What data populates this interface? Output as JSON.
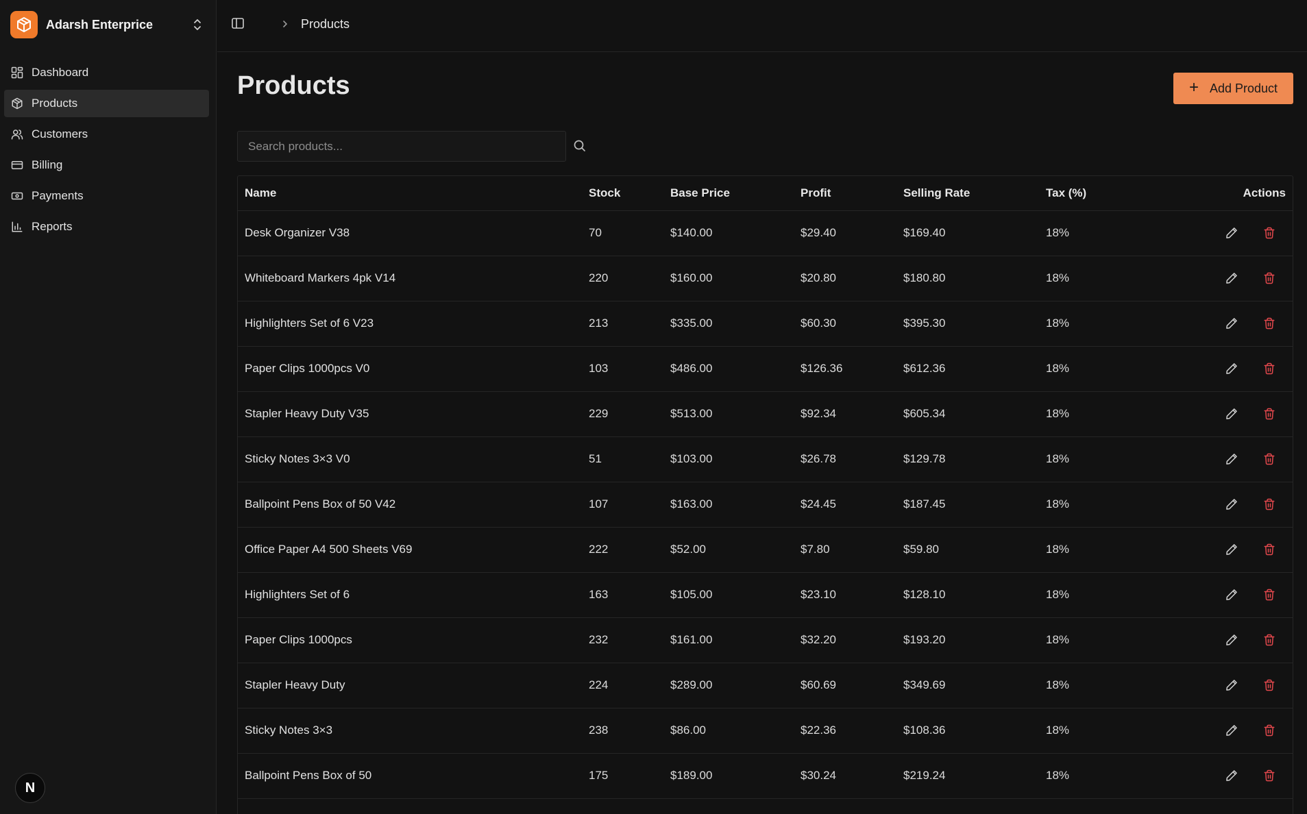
{
  "brand": {
    "name": "Adarsh Enterprice"
  },
  "sidebar": {
    "items": [
      {
        "label": "Dashboard",
        "icon": "dashboard-icon"
      },
      {
        "label": "Products",
        "icon": "package-icon",
        "active": true
      },
      {
        "label": "Customers",
        "icon": "users-icon"
      },
      {
        "label": "Billing",
        "icon": "card-icon"
      },
      {
        "label": "Payments",
        "icon": "banknote-icon"
      },
      {
        "label": "Reports",
        "icon": "bar-chart-icon"
      }
    ],
    "badge": "N"
  },
  "breadcrumb": {
    "current": "Products"
  },
  "main": {
    "title": "Products",
    "add_label": "Add Product",
    "search_placeholder": "Search products..."
  },
  "table": {
    "headers": [
      "Name",
      "Stock",
      "Base Price",
      "Profit",
      "Selling Rate",
      "Tax (%)",
      "Actions"
    ],
    "rows": [
      [
        "Desk Organizer V38",
        "70",
        "$140.00",
        "$29.40",
        "$169.40",
        "18%"
      ],
      [
        "Whiteboard Markers 4pk V14",
        "220",
        "$160.00",
        "$20.80",
        "$180.80",
        "18%"
      ],
      [
        "Highlighters Set of 6 V23",
        "213",
        "$335.00",
        "$60.30",
        "$395.30",
        "18%"
      ],
      [
        "Paper Clips 1000pcs V0",
        "103",
        "$486.00",
        "$126.36",
        "$612.36",
        "18%"
      ],
      [
        "Stapler Heavy Duty V35",
        "229",
        "$513.00",
        "$92.34",
        "$605.34",
        "18%"
      ],
      [
        "Sticky Notes 3×3 V0",
        "51",
        "$103.00",
        "$26.78",
        "$129.78",
        "18%"
      ],
      [
        "Ballpoint Pens Box of 50 V42",
        "107",
        "$163.00",
        "$24.45",
        "$187.45",
        "18%"
      ],
      [
        "Office Paper A4 500 Sheets V69",
        "222",
        "$52.00",
        "$7.80",
        "$59.80",
        "18%"
      ],
      [
        "Highlighters Set of 6",
        "163",
        "$105.00",
        "$23.10",
        "$128.10",
        "18%"
      ],
      [
        "Paper Clips 1000pcs",
        "232",
        "$161.00",
        "$32.20",
        "$193.20",
        "18%"
      ],
      [
        "Stapler Heavy Duty",
        "224",
        "$289.00",
        "$60.69",
        "$349.69",
        "18%"
      ],
      [
        "Sticky Notes 3×3",
        "238",
        "$86.00",
        "$22.36",
        "$108.36",
        "18%"
      ],
      [
        "Ballpoint Pens Box of 50",
        "175",
        "$189.00",
        "$30.24",
        "$219.24",
        "18%"
      ]
    ]
  },
  "colors": {
    "accent": "#ef8a52",
    "brand": "#f07a2a",
    "danger": "#e5484d"
  }
}
